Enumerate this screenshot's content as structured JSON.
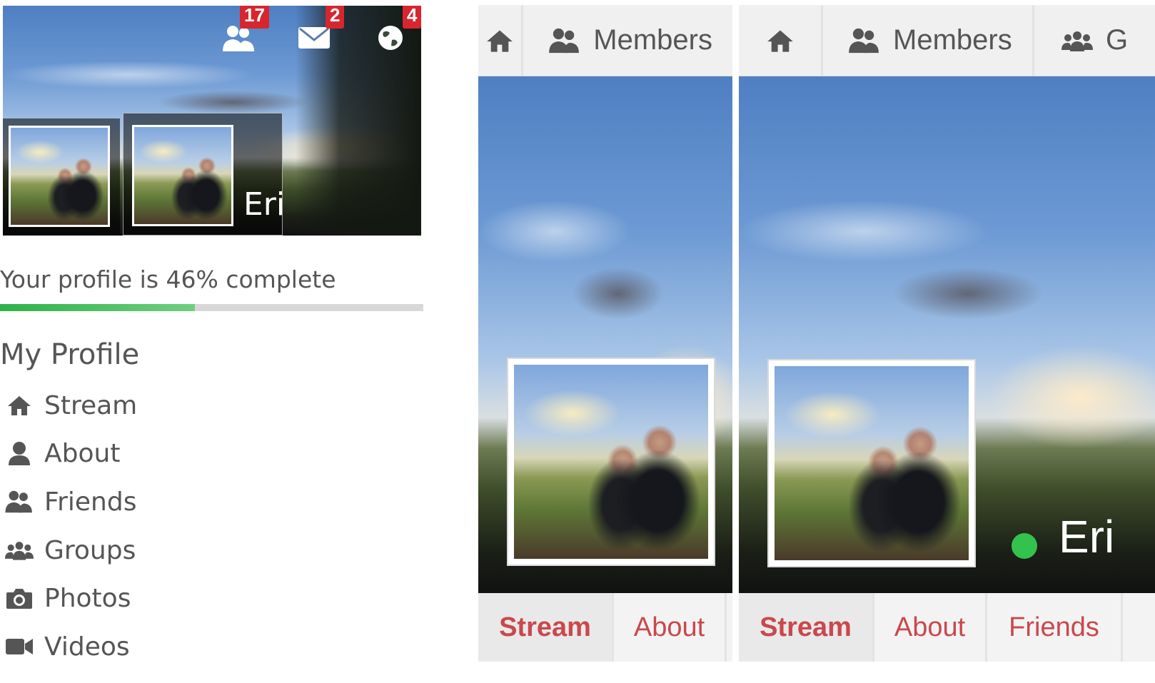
{
  "panel_left": {
    "cover_name": "Eri",
    "notifications": [
      {
        "icon": "friends-icon",
        "count": "17"
      },
      {
        "icon": "envelope-icon",
        "count": "2"
      },
      {
        "icon": "globe-icon",
        "count": "4"
      }
    ],
    "profile_progress": {
      "text": "Your profile is 46% complete",
      "percent": 46
    },
    "menu_title": "My Profile",
    "menu_items": [
      {
        "icon": "home-icon",
        "label": "Stream"
      },
      {
        "icon": "user-icon",
        "label": "About"
      },
      {
        "icon": "friends-icon",
        "label": "Friends"
      },
      {
        "icon": "groups-icon",
        "label": "Groups"
      },
      {
        "icon": "camera-icon",
        "label": "Photos"
      },
      {
        "icon": "video-icon",
        "label": "Videos"
      }
    ]
  },
  "panel_middle": {
    "top_nav": [
      {
        "icon": "home-icon",
        "label": ""
      },
      {
        "icon": "friends-icon",
        "label": "Members"
      }
    ],
    "sub_nav": [
      "Stream",
      "About"
    ]
  },
  "panel_right": {
    "top_nav": [
      {
        "icon": "home-icon",
        "label": ""
      },
      {
        "icon": "friends-icon",
        "label": "Members"
      },
      {
        "icon": "groups-icon",
        "label": "G"
      }
    ],
    "profile_name": "Eri",
    "online_status_color": "#33c24d",
    "sub_nav": [
      "Stream",
      "About",
      "Friends"
    ]
  },
  "colors": {
    "badge": "#d7262e",
    "progress": "#2db14a",
    "subnav_text": "#c9484c"
  }
}
